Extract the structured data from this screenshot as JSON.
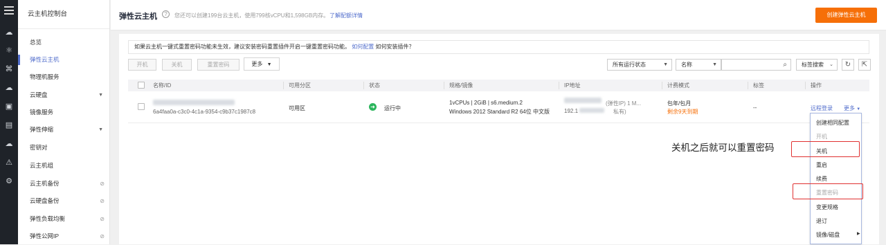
{
  "nav": {
    "title": "云主机控制台",
    "items": [
      {
        "label": "总览"
      },
      {
        "label": "弹性云主机"
      },
      {
        "label": "物理机服务"
      },
      {
        "label": "云硬盘"
      },
      {
        "label": "镜像服务"
      },
      {
        "label": "弹性伸缩"
      },
      {
        "label": "密钥对"
      },
      {
        "label": "云主机组"
      },
      {
        "label": "云主机备份"
      },
      {
        "label": "云硬盘备份"
      },
      {
        "label": "弹性负载均衡"
      },
      {
        "label": "弹性公网IP"
      }
    ]
  },
  "header": {
    "title": "弹性云主机",
    "quota_text": "您还可以创建199台云主机，使用799核vCPU和1,598GB内存。",
    "quota_link": "了解配额详情",
    "create_button": "创建弹性云主机"
  },
  "notice": {
    "text": "如果云主机一键式重置密码功能未生效，建议安装密码重置插件开启一键重置密码功能。",
    "link1": "如何配置",
    "link2": "如何安装插件？"
  },
  "toolbar": {
    "start": "开机",
    "stop": "关机",
    "reset_password": "重置密码",
    "more": "更多",
    "status_filter": "所有运行状态",
    "search_field": "名称",
    "tag_search": "标签搜索"
  },
  "table": {
    "headers": [
      "名称/ID",
      "可用分区",
      "状态",
      "规格/镜像",
      "IP地址",
      "计费模式",
      "标签",
      "操作"
    ],
    "row": {
      "id": "6a4faa0a-c3c0-4c1a-9354-c9b37c1987c8",
      "zone": "可用区",
      "status": "运行中",
      "spec": "1vCPUs | 2GiB | s6.medium.2",
      "image": "Windows 2012 Standard R2 64位 中文版",
      "ip_public_note": "(弹性IP)  1 M...",
      "ip_private": "192.1",
      "ip_private_note": "私有)",
      "billing": "包年/包月",
      "billing_note": "剩余9天到期",
      "tags": "--",
      "action_login": "远程登录",
      "action_more": "更多"
    }
  },
  "dropdown": {
    "items": [
      {
        "label": "创建相同配置",
        "disabled": false
      },
      {
        "label": "开机",
        "disabled": true
      },
      {
        "label": "关机",
        "disabled": false
      },
      {
        "label": "重启",
        "disabled": false
      },
      {
        "label": "续费",
        "disabled": false
      },
      {
        "label": "重置密码",
        "disabled": true
      },
      {
        "label": "变更规格",
        "disabled": false
      },
      {
        "label": "退订",
        "disabled": false
      },
      {
        "label": "镜像/磁盘",
        "disabled": false
      }
    ]
  },
  "annotation": "关机之后就可以重置密码",
  "colors": {
    "accent": "#526ecc",
    "primary_button": "#f66f08",
    "highlight": "#e03030",
    "running": "#2db55d"
  }
}
